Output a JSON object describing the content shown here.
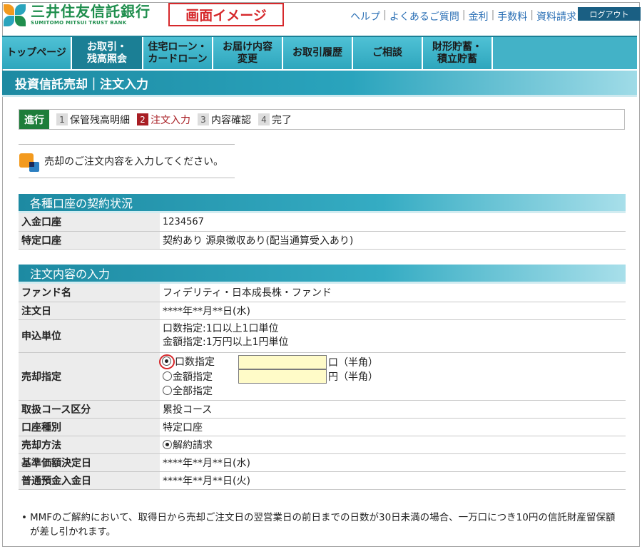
{
  "header": {
    "logo_jp": "三井住友信託銀行",
    "logo_en": "SUMITOMO MITSUI TRUST BANK",
    "image_badge": "画面イメージ",
    "links": [
      "ヘルプ",
      "よくあるご質問",
      "金利",
      "手数料",
      "資料請求"
    ],
    "logout": "ログアウト"
  },
  "nav": {
    "tabs": [
      {
        "line1": "トップページ",
        "line2": ""
      },
      {
        "line1": "お取引・",
        "line2": "残高照会"
      },
      {
        "line1": "住宅ローン・",
        "line2": "カードローン"
      },
      {
        "line1": "お届け内容",
        "line2": "変更"
      },
      {
        "line1": "お取引履歴",
        "line2": ""
      },
      {
        "line1": "ご相談",
        "line2": ""
      },
      {
        "line1": "財形貯蓄・",
        "line2": "積立貯蓄"
      }
    ],
    "active_index": 1
  },
  "page_title": "投資信託売却｜注文入力",
  "steps": {
    "label": "進行",
    "items": [
      {
        "num": "1",
        "label": "保管残高明細"
      },
      {
        "num": "2",
        "label": "注文入力"
      },
      {
        "num": "3",
        "label": "内容確認"
      },
      {
        "num": "4",
        "label": "完了"
      }
    ],
    "current": 2
  },
  "instruction": "売却のご注文内容を入力してください。",
  "accounts": {
    "title": "各種口座の契約状況",
    "rows": [
      {
        "key": "入金口座",
        "value": "1234567"
      },
      {
        "key": "特定口座",
        "value": "契約あり 源泉徴収あり(配当通算受入あり)"
      }
    ]
  },
  "order": {
    "title": "注文内容の入力",
    "fund_name_key": "ファンド名",
    "fund_name": "フィデリティ・日本成長株・ファンド",
    "order_date_key": "注文日",
    "order_date": "****年**月**日(水)",
    "unit_key": "申込単位",
    "unit_line1": "口数指定:1口以上1口単位",
    "unit_line2": "金額指定:1万円以上1円単位",
    "sell_key": "売却指定",
    "sell_options": [
      {
        "label": "口数指定",
        "suffix": "口（半角）",
        "value": "",
        "selected": true
      },
      {
        "label": "金額指定",
        "suffix": "円（半角）",
        "value": "",
        "selected": false
      },
      {
        "label": "全部指定",
        "suffix": "",
        "selected": false
      }
    ],
    "course_key": "取扱コース区分",
    "course": "累投コース",
    "account_type_key": "口座種別",
    "account_type": "特定口座",
    "method_key": "売却方法",
    "method": "解約請求",
    "base_date_key": "基準価額決定日",
    "base_date": "****年**月**日(水)",
    "deposit_date_key": "普通預金入金日",
    "deposit_date": "****年**月**日(火)"
  },
  "note": "MMFのご解約において、取得日から売却ご注文日の翌営業日の前日までの日数が30日未満の場合、一万口につき10円の信託財産留保額が差し引かれます。",
  "colors": {
    "brand_green": "#1f8e4d",
    "nav_teal": "#43b2c7",
    "nav_active": "#1b7f95",
    "accent_red": "#d6282b",
    "step_current": "#a81e24",
    "input_yellow": "#fffbc8"
  }
}
